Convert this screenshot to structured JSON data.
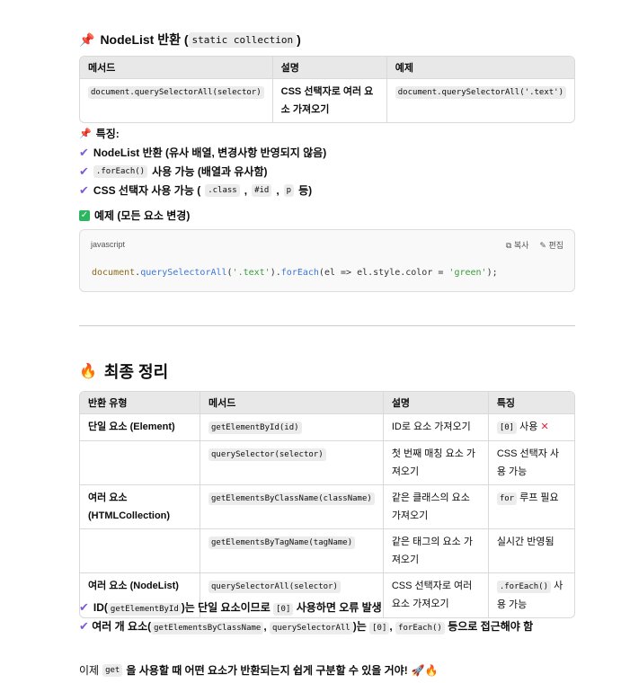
{
  "section1": {
    "icon": "pushpin",
    "title": "NodeList 반환 (",
    "title_code": "static collection",
    "title_end": ")"
  },
  "table1": {
    "headers": [
      "메서드",
      "설명",
      "예제"
    ],
    "row": {
      "method": "document.querySelectorAll(selector)",
      "desc": "CSS 선택자로 여러 요소 가져오기",
      "example": "document.querySelectorAll('.text')"
    }
  },
  "features": {
    "title": "특징:",
    "items": [
      {
        "text": "NodeList 반환 (유사 배열, 변경사항 반영되지 않음)"
      },
      {
        "code": ".forEach()",
        "text": "사용 가능 (배열과 유사함)"
      },
      {
        "text": "CSS 선택자 사용 가능 (",
        "c1": ".class",
        "c2": "#id",
        "c3": "p",
        "end": "등)"
      }
    ]
  },
  "example": {
    "title": "예제 (모든 요소 변경)"
  },
  "codeblock": {
    "lang": "javascript",
    "copy": "복사",
    "edit": "편집",
    "t1": "document",
    "t2": ".",
    "t3": "querySelectorAll",
    "t4": "(",
    "t5": "'.text'",
    "t6": ").",
    "t7": "forEach",
    "t8": "(el => el.style.color = ",
    "t9": "'green'",
    "t10": ");"
  },
  "summary": {
    "title": "최종 정리",
    "headers": [
      "반환 유형",
      "메서드",
      "설명",
      "특징"
    ],
    "rows": [
      {
        "type": "단일 요소 (Element)",
        "method": "getElementById(id)",
        "desc": "ID로 요소 가져오기",
        "feat_code": "[0]",
        "feat": "사용",
        "feat_icon": "✕"
      },
      {
        "type": "",
        "method": "querySelector(selector)",
        "desc": "첫 번째 매칭 요소 가져오기",
        "feat": "CSS 선택자 사용 가능"
      },
      {
        "type": "여러 요소 (HTMLCollection)",
        "method": "getElementsByClassName(className)",
        "desc": "같은 클래스의 요소 가져오기",
        "feat_code": "for",
        "feat": "루프 필요"
      },
      {
        "type": "",
        "method": "getElementsByTagName(tagName)",
        "desc": "같은 태그의 요소 가져오기",
        "feat": "실시간 반영됨"
      },
      {
        "type": "여러 요소 (NodeList)",
        "method": "querySelectorAll(selector)",
        "desc": "CSS 선택자로 여러 요소 가져오기",
        "feat_code": ".forEach()",
        "feat": "사용 가능"
      }
    ]
  },
  "notes": [
    {
      "a": "ID(",
      "c1": "getElementById",
      "b": ")는 단일 요소이므로",
      "c2": "[0]",
      "d": "사용하면 오류 발생"
    },
    {
      "a": "여러 개 요소(",
      "c1": "getElementsByClassName",
      "s": ",",
      "c2": "querySelectorAll",
      "b": ")는",
      "c3": "[0]",
      "s2": ",",
      "c4": "forEach()",
      "d": "등으로 접근해야 함"
    }
  ],
  "final": {
    "a": "이제",
    "code": "get",
    "b": "을 사용할 때 어떤 요소가 반환되는지 쉽게 구분할 수 있을 거야!",
    "emoji": "🚀🔥"
  }
}
